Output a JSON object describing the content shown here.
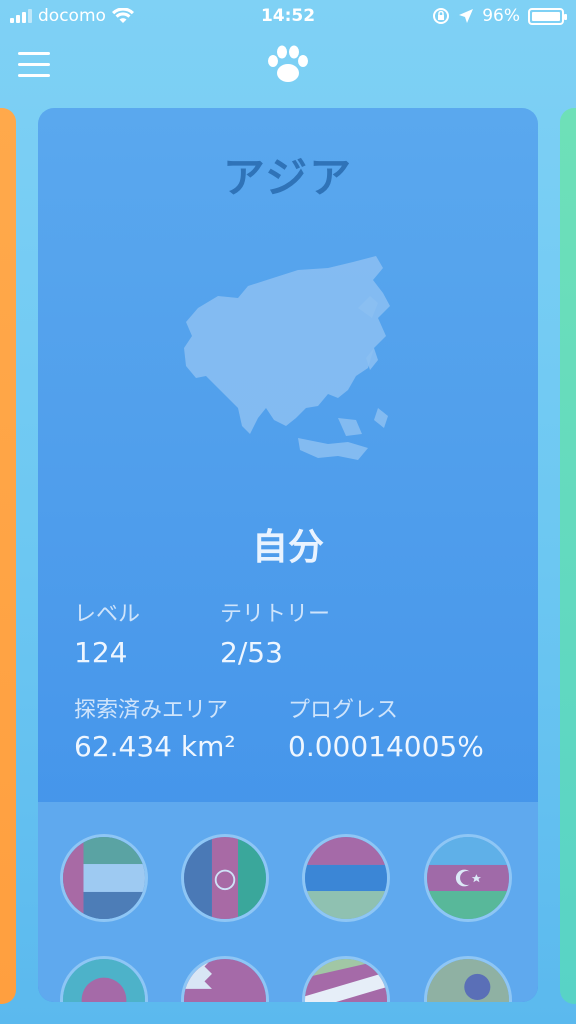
{
  "status_bar": {
    "carrier": "docomo",
    "time": "14:52",
    "battery_percent": "96%",
    "battery_level": 0.96
  },
  "nav": {
    "menu_icon": "hamburger-menu-icon",
    "logo_icon": "paw-icon"
  },
  "card": {
    "region_title": "アジア",
    "owner_name": "自分",
    "stats": {
      "level_label": "レベル",
      "level_value": "124",
      "territory_label": "テリトリー",
      "territory_value": "2/53",
      "explored_label": "探索済みエリア",
      "explored_value": "62.434 km²",
      "progress_label": "プログレス",
      "progress_value": "0.00014005%"
    }
  },
  "colors": {
    "background": "#6cc7f2",
    "card": "#4b9aeb",
    "left_card": "#ff9f3f",
    "right_card": "#58d3c6"
  }
}
